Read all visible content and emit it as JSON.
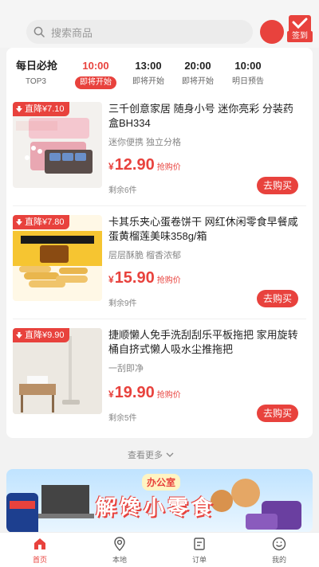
{
  "header": {
    "search_placeholder": "搜索商品",
    "checkin_label": "签到"
  },
  "flash_sale": {
    "title": "每日必抢",
    "subtitle": "TOP3",
    "slots": [
      {
        "time": "10:00",
        "status": "即将开始",
        "active": true
      },
      {
        "time": "13:00",
        "status": "即将开始",
        "active": false
      },
      {
        "time": "20:00",
        "status": "即将开始",
        "active": false
      },
      {
        "time": "10:00",
        "status": "明日预告",
        "active": false
      }
    ]
  },
  "products": [
    {
      "discount": "直降¥7.10",
      "title": "三千创意家居 随身小号 迷你亮彩 分装药盒BH334",
      "tags": "迷你便携   独立分格",
      "currency": "¥",
      "price": "12.90",
      "price_label": "抢购价",
      "remain": "剩余6件",
      "buy_label": "去购买"
    },
    {
      "discount": "直降¥7.80",
      "title": "卡其乐夹心蛋卷饼干 网红休闲零食早餐咸蛋黄榴莲美味358g/箱",
      "tags": "层层酥脆   榴香浓郁",
      "currency": "¥",
      "price": "15.90",
      "price_label": "抢购价",
      "remain": "剩余9件",
      "buy_label": "去购买"
    },
    {
      "discount": "直降¥9.90",
      "title": "捷顺懒人免手洗刮刮乐平板拖把 家用旋转桶自挤式懒人吸水尘推拖把",
      "tags": "一刮即净",
      "currency": "¥",
      "price": "19.90",
      "price_label": "抢购价",
      "remain": "剩余5件",
      "buy_label": "去购买"
    }
  ],
  "more_label": "查看更多",
  "banner": {
    "badge": "办公室",
    "title": "解馋小零食"
  },
  "nav": [
    {
      "label": "首页",
      "icon": "home-icon",
      "active": true
    },
    {
      "label": "本地",
      "icon": "location-icon",
      "active": false
    },
    {
      "label": "订单",
      "icon": "order-icon",
      "active": false
    },
    {
      "label": "我的",
      "icon": "profile-icon",
      "active": false
    }
  ],
  "colors": {
    "accent": "#e8423d"
  }
}
